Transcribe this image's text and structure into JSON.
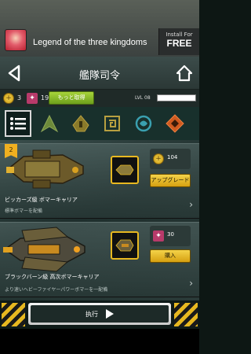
{
  "ad": {
    "title": "Legend of the three kingdoms",
    "install_small": "Install For",
    "install_big": "FREE"
  },
  "header": {
    "title": "艦隊司令"
  },
  "resources": {
    "coins": "3",
    "medals": "19",
    "more_label": "もっと取得",
    "level_label": "LVL 08",
    "level_progress": 0.0
  },
  "tabs": [
    {
      "name": "list",
      "active": true
    },
    {
      "name": "fighter",
      "active": false
    },
    {
      "name": "bomber",
      "active": false
    },
    {
      "name": "swirl",
      "active": false
    },
    {
      "name": "shield",
      "active": false
    },
    {
      "name": "target",
      "active": false
    }
  ],
  "ships": [
    {
      "badge": "2",
      "name": "ビッカーズ級 ボマーキャリア",
      "desc": "標準ボマーを配備",
      "price": "104",
      "currency": "coin",
      "action": "アップグレード"
    },
    {
      "badge": "",
      "name": "ブラックバーン級 高次ボマーキャリア",
      "desc": "より速いヘビーファイヤーパワーボマーを一配備",
      "price": "30",
      "currency": "medal",
      "action": "購入"
    }
  ],
  "footer": {
    "go_label": "执行"
  },
  "colors": {
    "accent": "#e8b820",
    "green": "#8cc02a",
    "panel": "#2a3a38"
  }
}
